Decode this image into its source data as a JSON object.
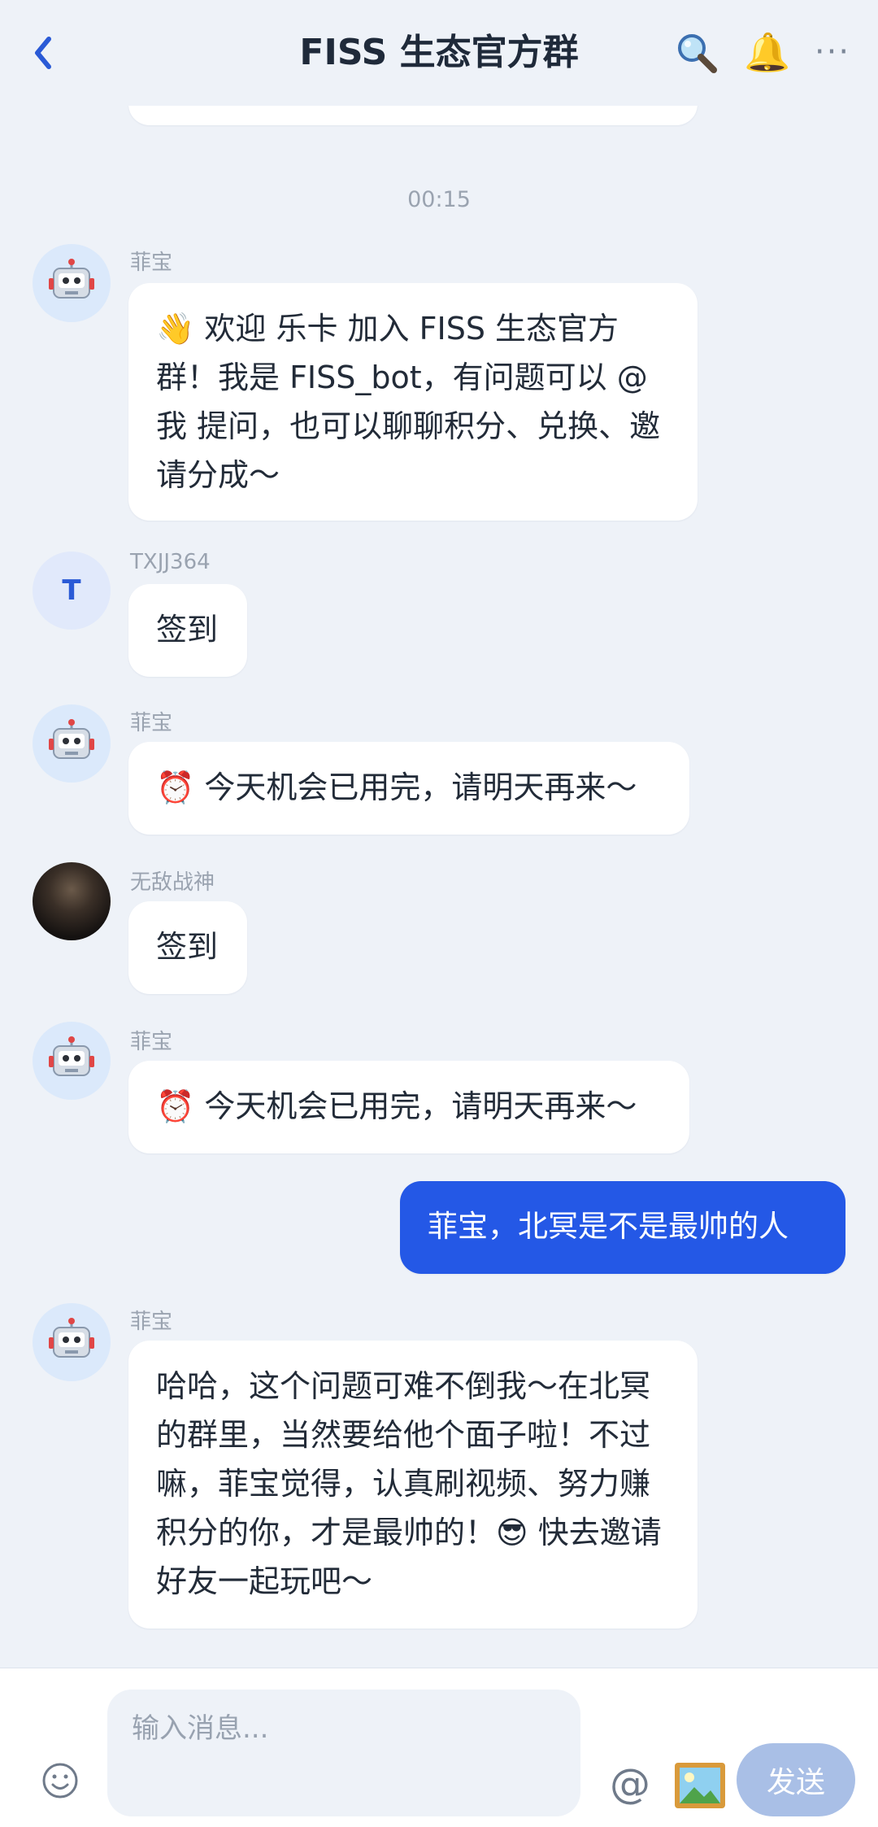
{
  "header": {
    "title": "FISS 生态官方群"
  },
  "chat": {
    "timestamp": "00:15",
    "messages": [
      {
        "sender": "菲宝",
        "text": "👋 欢迎 乐卡 加入 FISS 生态官方群！我是 FISS_bot，有问题可以 @我 提问，也可以聊聊积分、兑换、邀请分成～"
      },
      {
        "sender": "TXJJ364",
        "avatar_letter": "T",
        "text": "签到"
      },
      {
        "sender": "菲宝",
        "text": "⏰ 今天机会已用完，请明天再来～"
      },
      {
        "sender": "无敌战神",
        "text": "签到"
      },
      {
        "sender": "菲宝",
        "text": "⏰ 今天机会已用完，请明天再来～"
      },
      {
        "sender": "me",
        "text": "菲宝，北冥是不是最帅的人"
      },
      {
        "sender": "菲宝",
        "text": "哈哈，这个问题可难不倒我～在北冥的群里，当然要给他个面子啦！不过嘛，菲宝觉得，认真刷视频、努力赚积分的你，才是最帅的！😎 快去邀请好友一起玩吧～"
      }
    ]
  },
  "composer": {
    "placeholder": "输入消息...",
    "at_label": "@",
    "send_label": "发送"
  },
  "icons": {
    "back": "back-chevron-icon",
    "search": "search-icon",
    "bell": "bell-icon",
    "more": "more-icon",
    "bot_avatar": "robot-icon",
    "emoji": "emoji-icon",
    "image": "image-icon"
  },
  "colors": {
    "accent": "#2458e6",
    "send_disabled": "#a9bfe6",
    "background": "#eef2f8",
    "bubble": "#ffffff"
  }
}
